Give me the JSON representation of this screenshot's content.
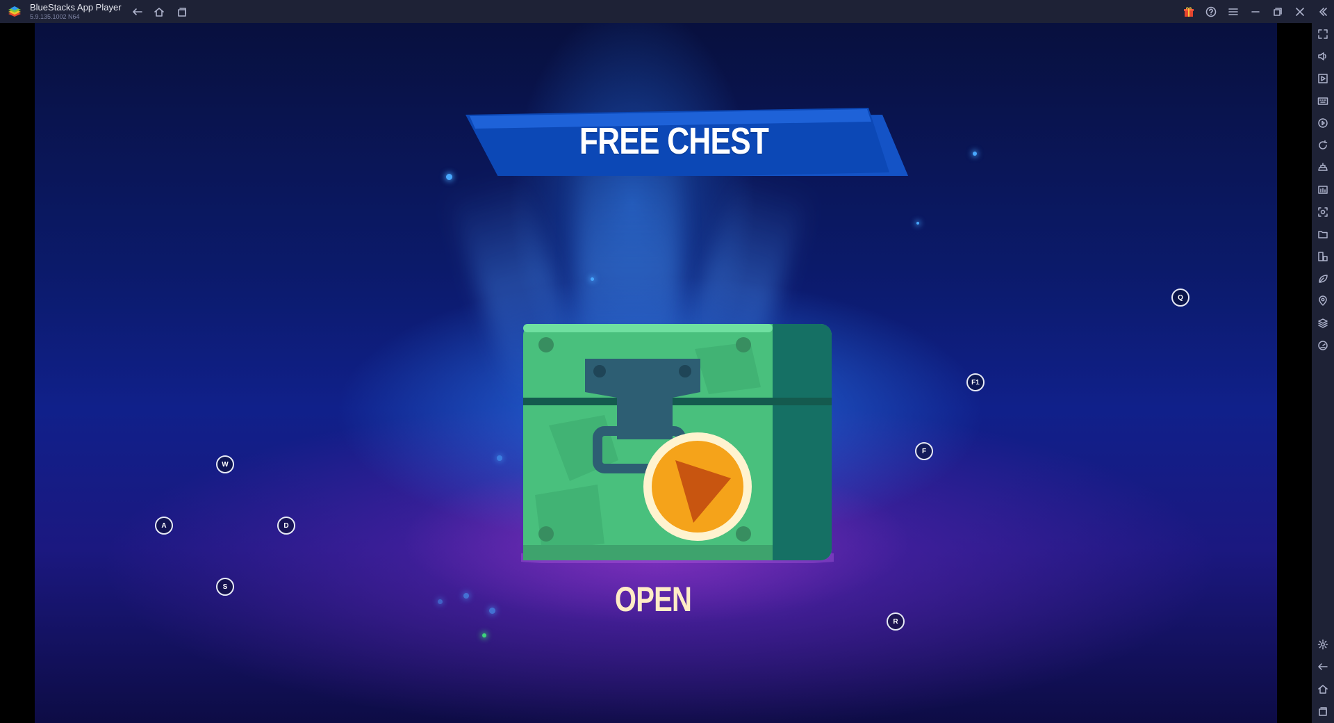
{
  "window": {
    "app_title": "BlueStacks App Player",
    "app_version": "5.9.135.1002 N64"
  },
  "titlebar": {
    "nav_icons": [
      "back-arrow-icon",
      "home-icon",
      "multi-instance-icon"
    ],
    "right_icons": [
      "gift-icon",
      "help-icon",
      "menu-icon",
      "minimize-icon",
      "restore-icon",
      "close-icon",
      "collapse-sidebar-icon"
    ]
  },
  "sidebar": {
    "top_icons": [
      "fullscreen-icon",
      "volume-icon",
      "media-icon",
      "keyboard-controls-icon",
      "macro-recorder-icon",
      "sync-icon",
      "game-controls-icon",
      "screenshot-multi-icon",
      "screenshot-icon",
      "folder-icon",
      "multi-instance-manager-icon",
      "eco-mode-icon",
      "location-icon",
      "layers-icon",
      "performance-icon"
    ],
    "bottom_icons": [
      "settings-icon",
      "back-icon",
      "home-icon",
      "recent-apps-icon"
    ]
  },
  "game": {
    "banner_title": "FREE CHEST",
    "action_label": "OPEN",
    "colors": {
      "banner_front": "#0d47b8",
      "banner_back": "#1658d4",
      "chest_green": "#4cc27f",
      "chest_dark": "#156e5e",
      "play_orange": "#f5a31a"
    }
  },
  "key_hints": [
    {
      "key": "Q"
    },
    {
      "key": "F1"
    },
    {
      "key": "F"
    },
    {
      "key": "W"
    },
    {
      "key": "A"
    },
    {
      "key": "D"
    },
    {
      "key": "S"
    },
    {
      "key": "R"
    }
  ]
}
